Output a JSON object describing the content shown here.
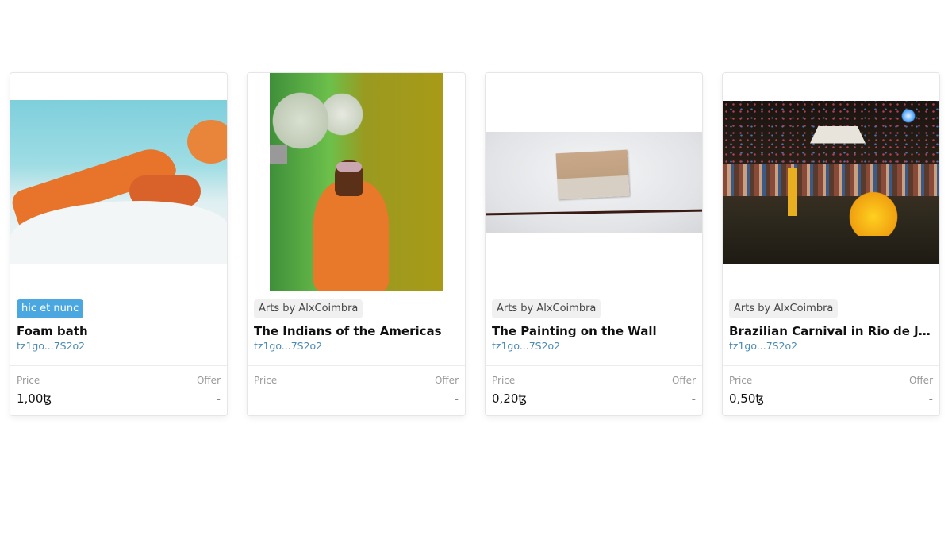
{
  "labels": {
    "price": "Price",
    "offer": "Offer"
  },
  "cards": [
    {
      "tag": "hic et nunc",
      "tag_style": "primary",
      "title": "Foam bath",
      "creator": "tz1go...7S2o2",
      "price": "1,00ꜩ",
      "offer": "-"
    },
    {
      "tag": "Arts by AlxCoimbra",
      "tag_style": "neutral",
      "title": "The Indians of the Americas",
      "creator": "tz1go...7S2o2",
      "price": "",
      "offer": "-"
    },
    {
      "tag": "Arts by AlxCoimbra",
      "tag_style": "neutral",
      "title": "The Painting on the Wall",
      "creator": "tz1go...7S2o2",
      "price": "0,20ꜩ",
      "offer": "-"
    },
    {
      "tag": "Arts by AlxCoimbra",
      "tag_style": "neutral",
      "title": "Brazilian Carnival in Rio de Jan...",
      "creator": "tz1go...7S2o2",
      "price": "0,50ꜩ",
      "offer": "-"
    }
  ],
  "colors": {
    "primary_tag": "#4aa7e0",
    "creator_link": "#4a8ab5"
  }
}
